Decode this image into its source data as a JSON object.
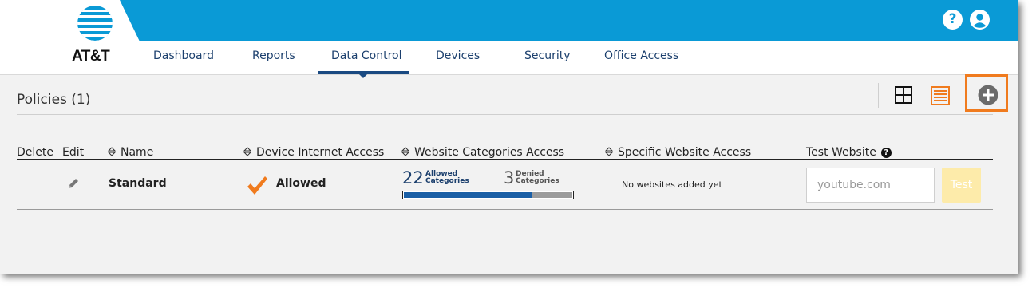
{
  "brand": {
    "name": "AT&T",
    "color": "#0a9ad6",
    "globe_icon": "att-globe-icon"
  },
  "header": {
    "help_icon": "?",
    "user_icon": "user-circle-icon"
  },
  "nav": {
    "items": [
      {
        "label": "Dashboard"
      },
      {
        "label": "Reports"
      },
      {
        "label": "Data Control",
        "active": true
      },
      {
        "label": "Devices"
      },
      {
        "label": "Security"
      },
      {
        "label": "Office Access"
      }
    ]
  },
  "page": {
    "title": "Policies (1)"
  },
  "toolbar": {
    "grid_view_icon": "grid-view-icon",
    "list_view_icon": "list-view-icon",
    "add_icon": "add-circle-icon",
    "accent": "#f07b1e"
  },
  "table": {
    "headers": {
      "delete": "Delete",
      "edit": "Edit",
      "name": "Name",
      "device": "Device Internet Access",
      "categories": "Website Categories Access",
      "specific": "Specific Website Access",
      "test": "Test Website"
    },
    "rows": [
      {
        "name": "Standard",
        "device_access": "Allowed",
        "allowed_count": "22",
        "allowed_label_1": "Allowed",
        "allowed_label_2": "Categories",
        "denied_count": "3",
        "denied_label_1": "Denied",
        "denied_label_2": "Categories",
        "allowed_fraction": 0.76,
        "specific_access": "No websites added yet",
        "test_placeholder": "youtube.com",
        "test_button": "Test"
      }
    ]
  }
}
